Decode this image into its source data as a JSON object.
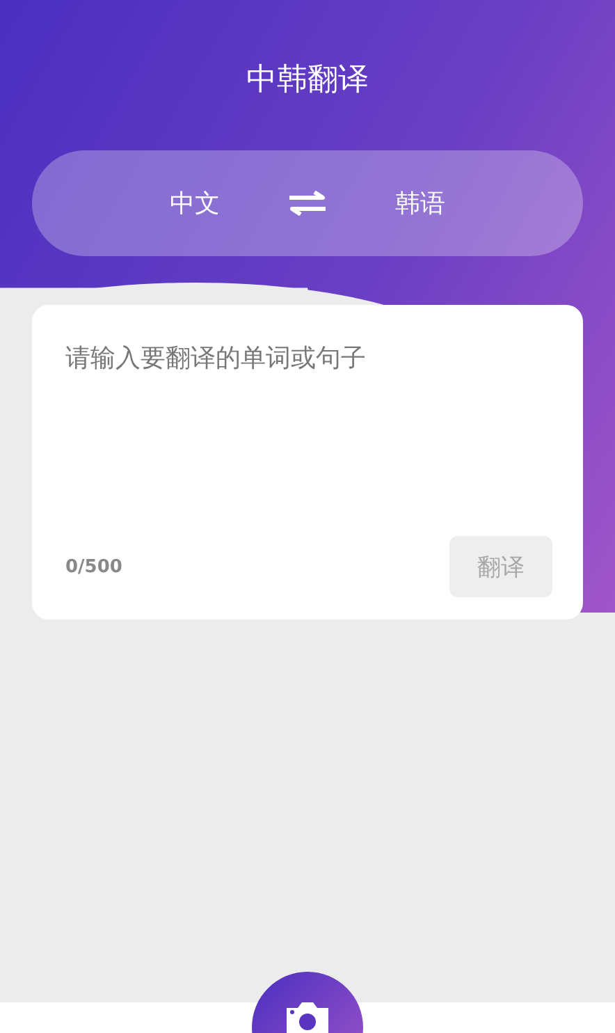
{
  "header": {
    "title": "中韩翻译"
  },
  "language_switch": {
    "source": "中文",
    "target": "韩语"
  },
  "input": {
    "placeholder": "请输入要翻译的单词或句子",
    "counter": "0/500"
  },
  "translate_button": {
    "label": "翻译",
    "disabled": true
  }
}
